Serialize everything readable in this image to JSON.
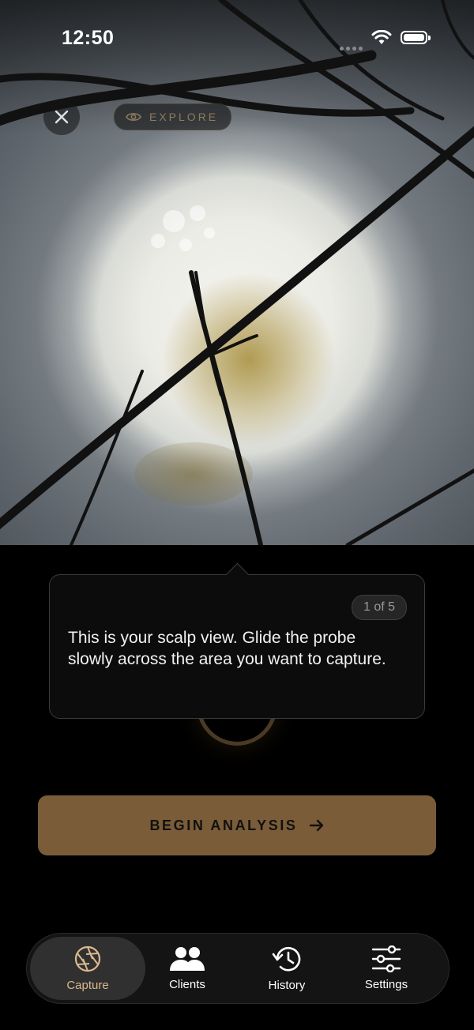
{
  "status_bar": {
    "time": "12:50"
  },
  "top_controls": {
    "explore_label": "EXPLORE"
  },
  "tooltip": {
    "step": "1 of 5",
    "message": "This is your scalp view. Glide the probe slowly across the area you want to capture."
  },
  "begin_button": {
    "label": "BEGIN ANALYSIS"
  },
  "tab_bar": {
    "active_tab": "Capture",
    "tabs": [
      {
        "label": "Capture",
        "icon": "aperture-icon"
      },
      {
        "label": "Clients",
        "icon": "users-icon"
      },
      {
        "label": "History",
        "icon": "history-icon"
      },
      {
        "label": "Settings",
        "icon": "sliders-icon"
      }
    ]
  },
  "colors": {
    "accent": "#7a5c38",
    "accent_light": "#d9b98f",
    "background": "#000000",
    "tooltip_bg": "#0c0c0c"
  }
}
